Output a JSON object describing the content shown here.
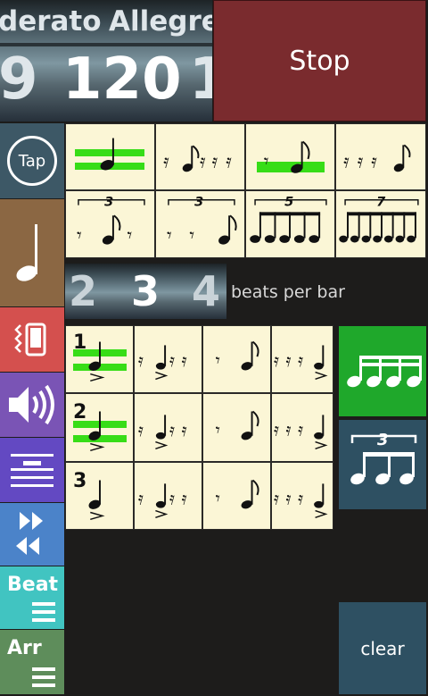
{
  "tempo": {
    "names": [
      "derato",
      "Allegrett"
    ],
    "bpm_left": "9",
    "bpm_value": "120",
    "bpm_right": "1"
  },
  "stop_label": "Stop",
  "tap_label": "Tap",
  "beats": {
    "left": "2",
    "value": "3",
    "right": "4",
    "label": "beats per bar"
  },
  "tuplets": {
    "triplet": "3",
    "quintuplet": "5",
    "septuplet": "7"
  },
  "bar_numbers": [
    "1",
    "2",
    "3"
  ],
  "sidebar": {
    "beat_label": "Beat",
    "arr_label": "Arr"
  },
  "clear_label": "clear",
  "colors": {
    "highlight": "#37dd17",
    "stop_bg": "#7a2b2e",
    "sheet": "#fbf6d6",
    "tap_bg": "#3d5866",
    "note_bg": "#8b6743",
    "vibrate_bg": "#d4504e",
    "sound_bg": "#7a54b5",
    "lines_bg": "#6349c2",
    "speed_bg": "#4b83c9",
    "beat_bg": "#41c4c1",
    "arr_bg": "#5e8d5b",
    "sixteenths_bg": "#1fa82b",
    "triplets_bg": "#2e5062",
    "clear_bg": "#2e5062"
  }
}
